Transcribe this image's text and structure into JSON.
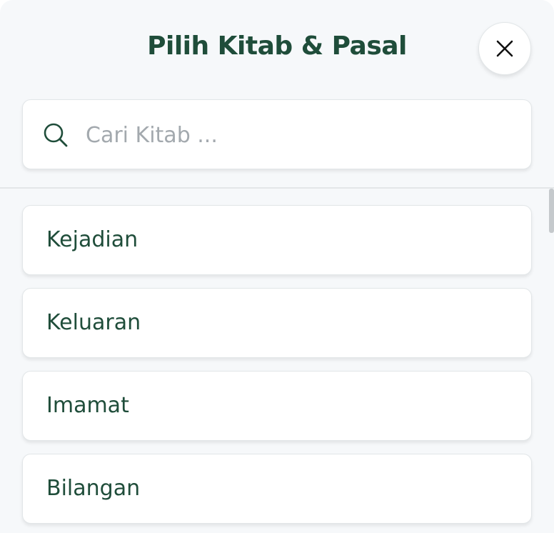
{
  "header": {
    "title": "Pilih Kitab & Pasal",
    "close_icon": "close-icon"
  },
  "search": {
    "icon": "search-icon",
    "placeholder": "Cari Kitab ...",
    "value": ""
  },
  "books": [
    {
      "label": "Kejadian"
    },
    {
      "label": "Keluaran"
    },
    {
      "label": "Imamat"
    },
    {
      "label": "Bilangan"
    }
  ],
  "colors": {
    "accent": "#1f4d3a",
    "background": "#f6f8fa",
    "card": "#ffffff",
    "placeholder": "#a3a9ae"
  }
}
